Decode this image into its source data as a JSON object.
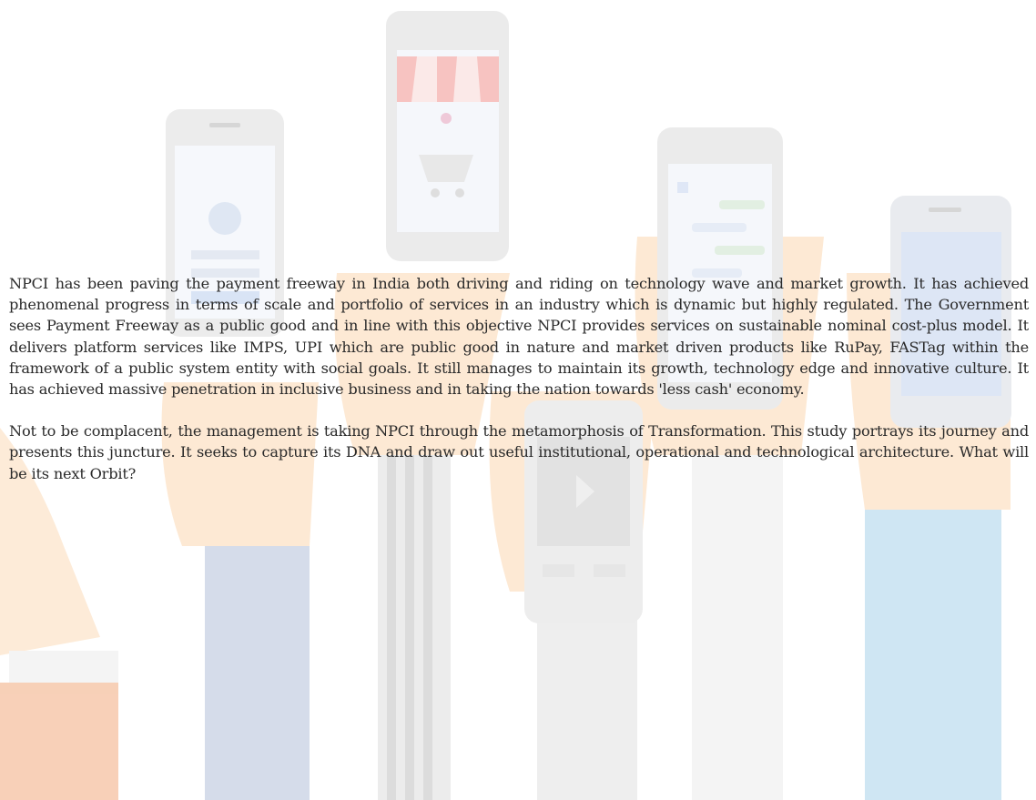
{
  "document": {
    "paragraphs": [
      "NPCI has been paving the payment freeway in India both driving and riding on technology wave and market growth. It has achieved phenomenal progress in terms of scale and portfolio of services in an industry which is dynamic but highly regulated. The Government sees Payment Freeway as a public good and in line with this objective NPCI provides services on sustainable nominal cost-plus model.  It delivers platform services like IMPS, UPI which are public good in nature and market driven products like RuPay, FASTag within the framework of a public system entity with social goals. It still manages to maintain its growth, technology edge and innovative culture. It has achieved massive penetration in inclusive business and in taking the nation towards 'less cash' economy.",
      "Not to be complacent, the management is taking NPCI through the metamorphosis of Transformation. This study portrays its journey and presents this juncture. It seeks to capture its DNA and draw out useful institutional, operational and technological architecture.  What will be its next Orbit?"
    ]
  },
  "illustration": {
    "subject": "hands-holding-smartphones",
    "colors": {
      "phone_frame": "#e7e7e7",
      "screen": "#f3f6fb",
      "sleeve_blue": "#d5dcea",
      "sleeve_orange": "#fbe2cf",
      "sleeve_teal": "#cfe6f3",
      "skin": "#fde9d4",
      "stripe": "#e6e6e6",
      "awning_red": "#f7c3c1"
    }
  }
}
